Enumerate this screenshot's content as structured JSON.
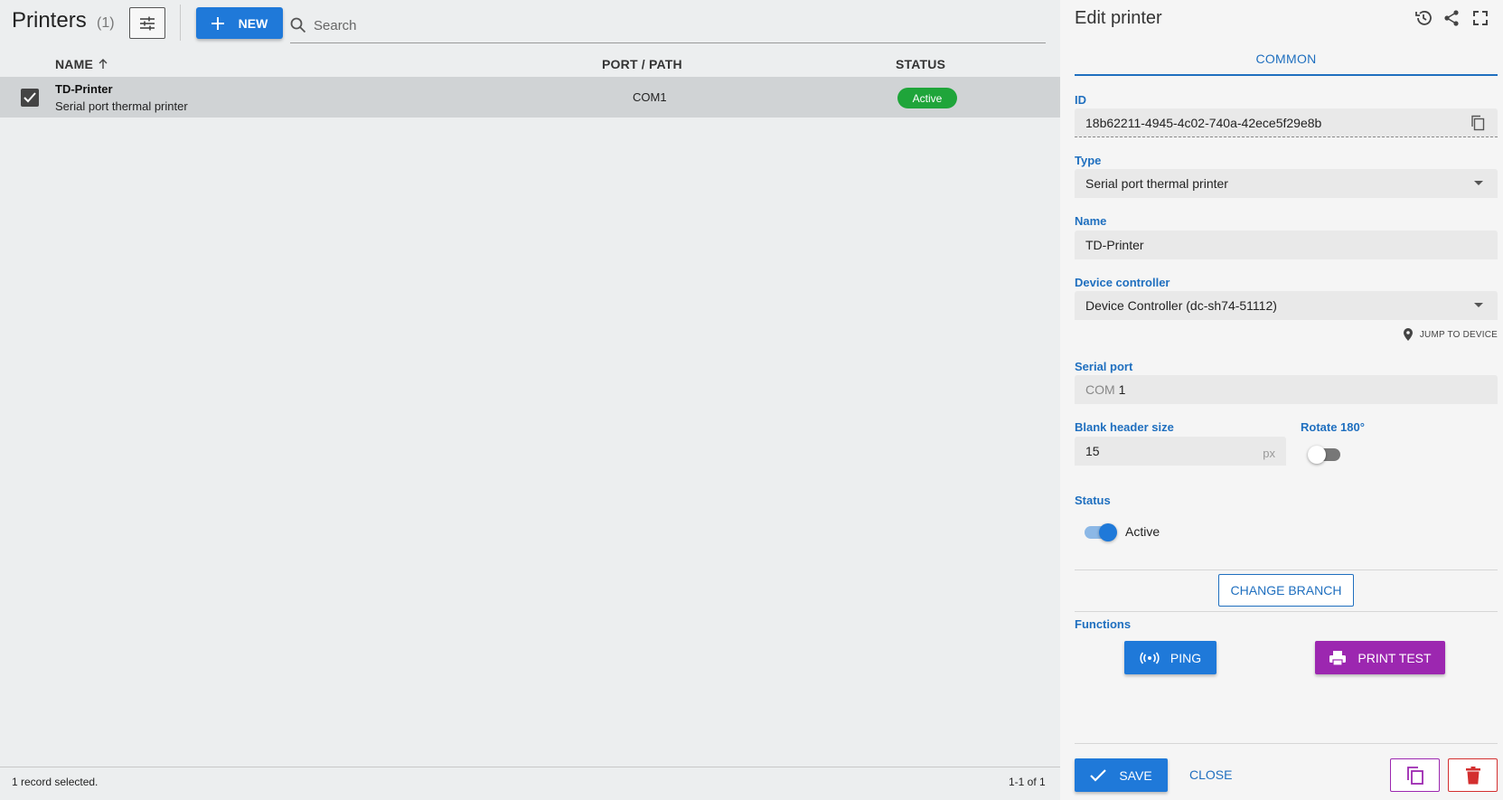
{
  "list": {
    "title": "Printers",
    "count": "(1)",
    "new_label": "NEW",
    "search_placeholder": "Search",
    "columns": {
      "name": "NAME",
      "port": "PORT / PATH",
      "status": "STATUS"
    },
    "rows": [
      {
        "name": "TD-Printer",
        "description": "Serial port thermal printer",
        "port": "COM1",
        "status": "Active",
        "selected": true
      }
    ],
    "footer_selection": "1 record selected.",
    "footer_pagination": "1-1 of 1"
  },
  "edit": {
    "title": "Edit printer",
    "tab": "COMMON",
    "id_label": "ID",
    "id_value": "18b62211-4945-4c02-740a-42ece5f29e8b",
    "type_label": "Type",
    "type_value": "Serial port thermal printer",
    "name_label": "Name",
    "name_value": "TD-Printer",
    "controller_label": "Device controller",
    "controller_value": "Device Controller (dc-sh74-51112)",
    "jump_label": "JUMP TO DEVICE",
    "serial_label": "Serial port",
    "serial_prefix": "COM",
    "serial_value": "1",
    "blank_label": "Blank header size",
    "blank_value": "15",
    "blank_suffix": "px",
    "rotate_label": "Rotate 180°",
    "rotate_on": false,
    "status_label": "Status",
    "status_value": "Active",
    "status_on": true,
    "change_branch_label": "CHANGE BRANCH",
    "functions_label": "Functions",
    "ping_label": "PING",
    "print_test_label": "PRINT TEST",
    "save_label": "SAVE",
    "close_label": "CLOSE"
  },
  "colors": {
    "accent": "#1f79d9",
    "purple": "#9c27b0",
    "active_green": "#1fa53a",
    "danger": "#d32f2f"
  },
  "icons": [
    "filter-icon",
    "plus-icon",
    "search-icon",
    "sort-arrow-icon",
    "check-icon",
    "history-icon",
    "share-icon",
    "fullscreen-icon",
    "copy-icon",
    "location-pin-icon",
    "ping-icon",
    "printer-icon",
    "duplicate-icon",
    "trash-icon"
  ]
}
